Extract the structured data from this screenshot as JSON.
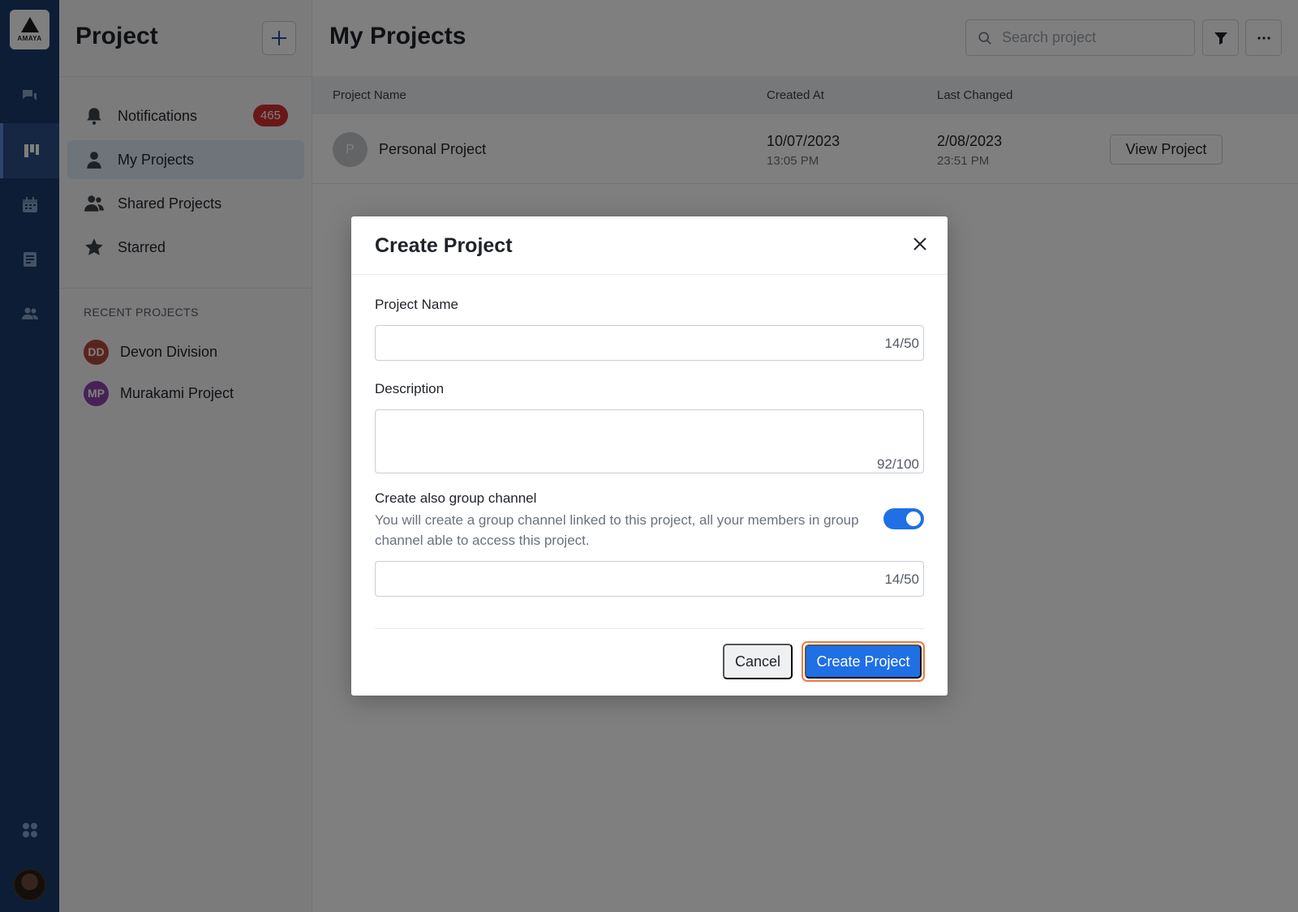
{
  "app": {
    "logo_text": "AMAYA"
  },
  "rail": {
    "items": [
      {
        "name": "chat",
        "icon": "chat-icon"
      },
      {
        "name": "projects",
        "icon": "board-icon",
        "active": true
      },
      {
        "name": "calendar",
        "icon": "calendar-icon"
      },
      {
        "name": "docs",
        "icon": "document-icon"
      },
      {
        "name": "people",
        "icon": "people-icon"
      }
    ],
    "bottom": {
      "apps_icon": "apps-grid-icon"
    }
  },
  "sidebar": {
    "title": "Project",
    "add_icon": "plus-icon",
    "nav": [
      {
        "label": "Notifications",
        "icon": "bell-icon",
        "badge": "465"
      },
      {
        "label": "My Projects",
        "icon": "user-icon",
        "active": true
      },
      {
        "label": "Shared Projects",
        "icon": "users-icon"
      },
      {
        "label": "Starred",
        "icon": "star-icon"
      }
    ],
    "recent_title": "RECENT PROJECTS",
    "recent": [
      {
        "initials": "DD",
        "label": "Devon Division",
        "color": "#b5483c"
      },
      {
        "initials": "MP",
        "label": "Murakami Project",
        "color": "#8e44ad"
      }
    ]
  },
  "main": {
    "title": "My Projects",
    "search": {
      "placeholder": "Search project",
      "value": ""
    },
    "table": {
      "columns": [
        "Project Name",
        "Created At",
        "Last Changed"
      ],
      "rows": [
        {
          "initial": "P",
          "name": "Personal Project",
          "created_date": "10/07/2023",
          "created_time": "13:05 PM",
          "changed_date": "2/08/2023",
          "changed_time": "23:51 PM",
          "action": "View Project"
        }
      ]
    }
  },
  "modal": {
    "title": "Create Project",
    "project_name_label": "Project Name",
    "project_name_value": "",
    "project_name_count": "14/50",
    "description_label": "Description",
    "description_value": "",
    "description_count": "92/100",
    "group_channel_title": "Create also group channel",
    "group_channel_desc": "You will create a group channel linked to this project, all your members in group channel able to access this project.",
    "group_channel_enabled": true,
    "channel_name_value": "",
    "channel_name_count": "14/50",
    "cancel_label": "Cancel",
    "create_label": "Create Project"
  },
  "colors": {
    "rail_bg": "#1b3a6b",
    "primary": "#1f6fe5",
    "badge": "#d23030",
    "focus_ring": "#ef7b45"
  }
}
